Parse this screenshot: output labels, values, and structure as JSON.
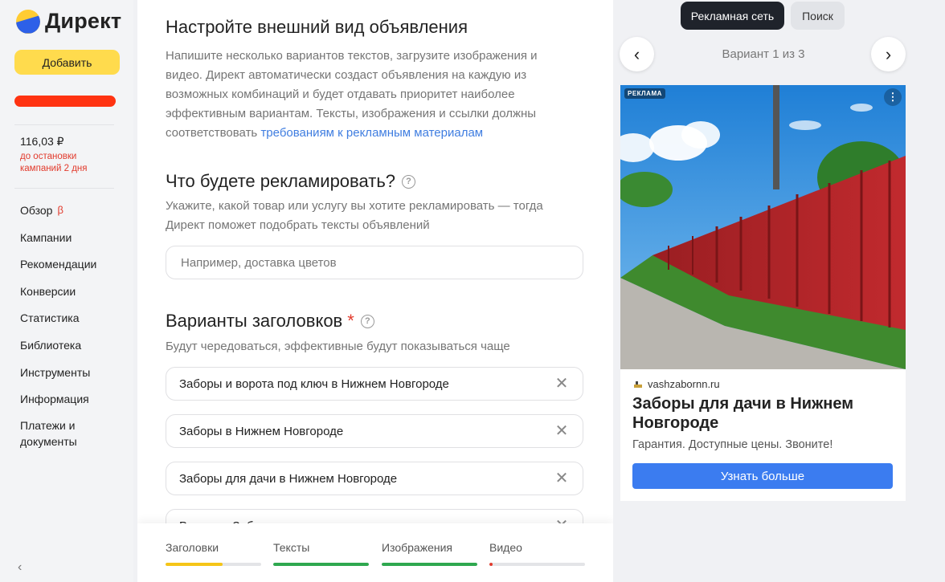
{
  "sidebar": {
    "logo_text": "Директ",
    "add_button": "Добавить",
    "balance": "116,03 ₽",
    "balance_note": "до остановки кампаний 2 дня",
    "nav": [
      {
        "label": "Обзор",
        "badge": "β"
      },
      {
        "label": "Кампании"
      },
      {
        "label": "Рекомендации"
      },
      {
        "label": "Конверсии"
      },
      {
        "label": "Статистика"
      },
      {
        "label": "Библиотека"
      },
      {
        "label": "Инструменты"
      },
      {
        "label": "Информация"
      },
      {
        "label": "Платежи и документы"
      }
    ],
    "collapse_icon": "‹"
  },
  "form": {
    "title": "Настройте внешний вид объявления",
    "intro": "Напишите несколько вариантов текстов, загрузите изображения и видео. Директ автоматически создаст объявления на каждую из возможных комбинаций и будет отдавать приоритет наиболее эффективным вариантам. Тексты, изображения и ссылки должны соответствовать",
    "intro_link": "требованиям к рекламным материалам",
    "what_title": "Что будете рекламировать?",
    "what_hint": "Укажите, какой товар или услугу вы хотите рекламировать — тогда Директ поможет подобрать тексты объявлений",
    "what_placeholder": "Например, доставка цветов",
    "headlines_title": "Варианты заголовков",
    "required_mark": "*",
    "headlines_hint": "Будут чередоваться, эффективные будут показываться чаще",
    "headlines": [
      "Заборы и ворота под ключ в Нижнем Новгороде",
      "Заборы в Нижнем Новгороде",
      "Заборы для дачи в Нижнем Новгороде",
      "Ворота и Заборы"
    ],
    "help_icon": "?",
    "clear_icon": "✕"
  },
  "progress": [
    {
      "label": "Заголовки",
      "fill": 0.6,
      "color": "#f5c518"
    },
    {
      "label": "Тексты",
      "fill": 1.0,
      "color": "#2fa84f"
    },
    {
      "label": "Изображения",
      "fill": 1.0,
      "color": "#2fa84f"
    },
    {
      "label": "Видео",
      "fill": 0.03,
      "color": "#e23a2c"
    }
  ],
  "preview": {
    "tabs": [
      "Рекламная сеть",
      "Поиск"
    ],
    "active_tab": 0,
    "variant": "Вариант 1 из 3",
    "prev_icon": "‹",
    "next_icon": "›",
    "ad_label": "РЕКЛАМА",
    "menu_icon": "⋮",
    "domain": "vashzabornn.ru",
    "title": "Заборы для дачи в Нижнем Новгороде",
    "text": "Гарантия. Доступные цены. Звоните!",
    "cta": "Узнать больше"
  }
}
